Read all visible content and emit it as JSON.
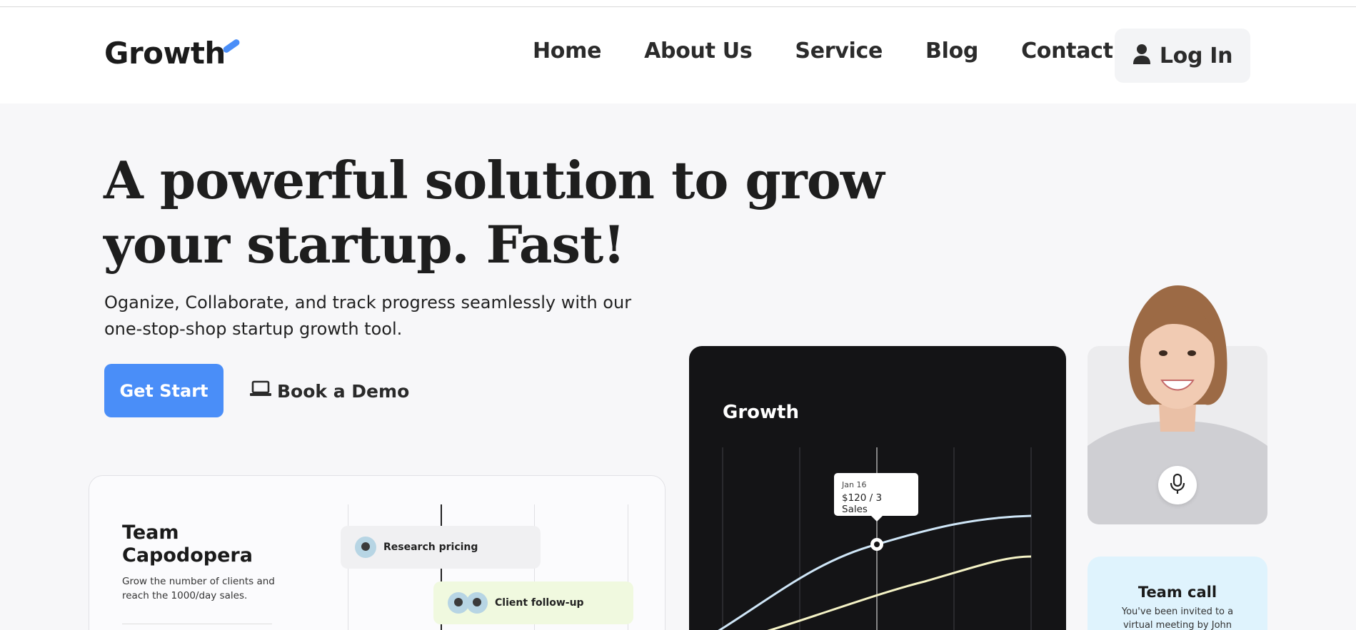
{
  "brand": {
    "logo_text": "Growth",
    "accent_color": "#4a8ef8"
  },
  "nav": {
    "items": [
      {
        "label": "Home"
      },
      {
        "label": "About Us"
      },
      {
        "label": "Service"
      },
      {
        "label": "Blog"
      },
      {
        "label": "Contact"
      }
    ],
    "login_label": "Log In",
    "login_icon": "user-icon"
  },
  "hero": {
    "title": "A powerful solution to grow your startup. Fast!",
    "subtitle": "Oganize, Collaborate, and track progress seamlessly with our one-stop-shop startup growth tool.",
    "primary_button": "Get Start",
    "secondary_button": "Book a Demo",
    "secondary_icon": "laptop-icon"
  },
  "team_card": {
    "title": "Team Capodopera",
    "description": "Grow the number of clients and reach the 1000/day sales.",
    "tasks": [
      {
        "label": "Research pricing"
      },
      {
        "label": "Client follow-up"
      }
    ]
  },
  "growth_card": {
    "title": "Growth",
    "tooltip_date": "Jan 16",
    "tooltip_value": "$120 / 3 Sales",
    "series_colors": [
      "#cfe6f7",
      "#f5f3c6"
    ]
  },
  "profile_card": {
    "mic_icon": "microphone-icon"
  },
  "call_card": {
    "title": "Team call",
    "text": "You've been invited to a virtual meeting by John"
  }
}
